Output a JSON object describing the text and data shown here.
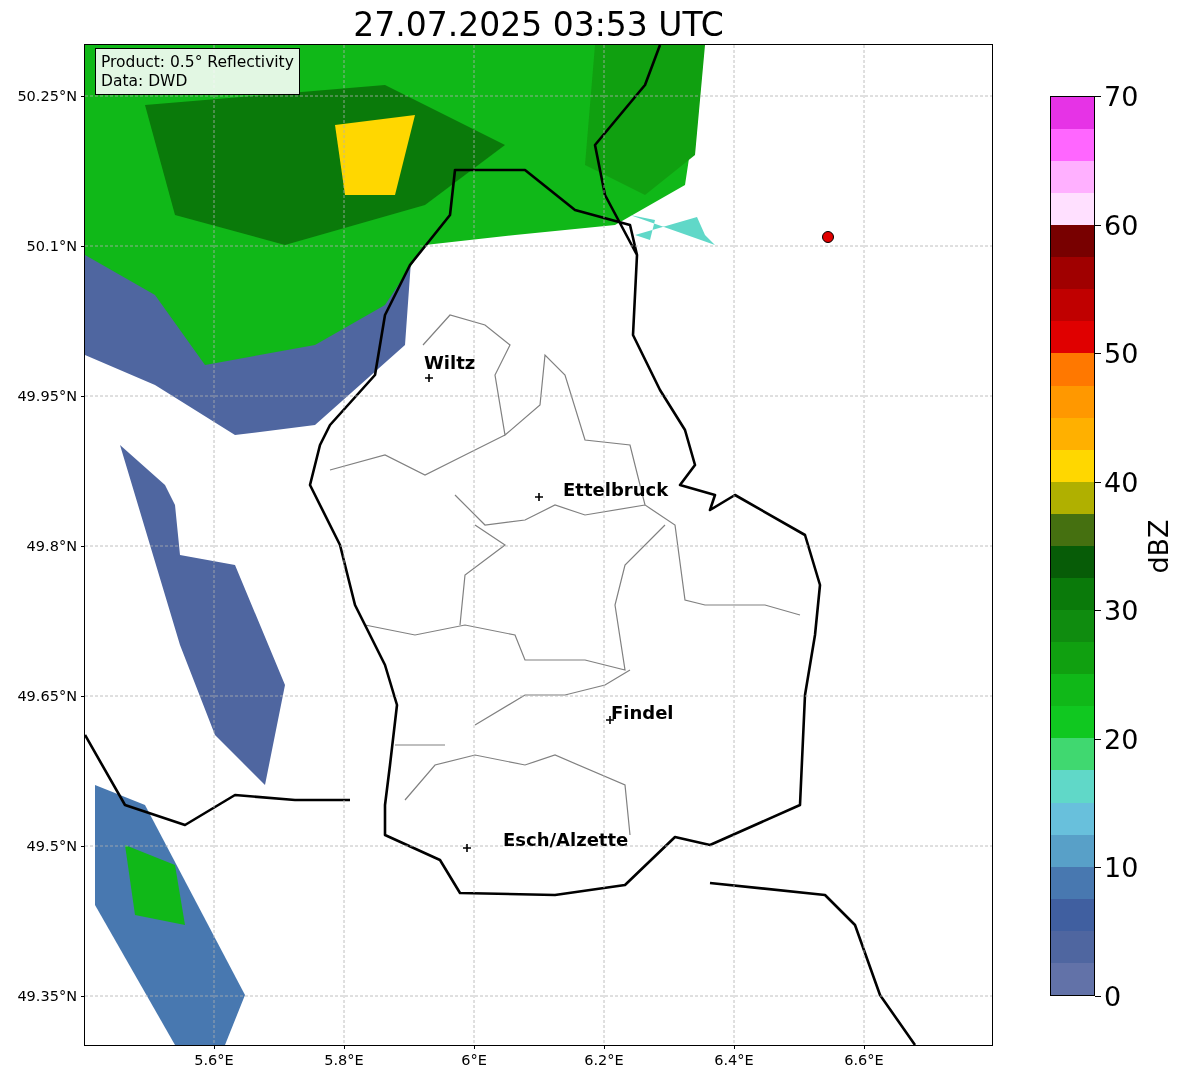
{
  "title": "27.07.2025 03:53 UTC",
  "info_box": {
    "lines": [
      "Product: 0.5° Reflectivity",
      "Data: DWD"
    ]
  },
  "map": {
    "cities": [
      {
        "name": "Wiltz"
      },
      {
        "name": "Ettelbruck"
      },
      {
        "name": "Findel"
      },
      {
        "name": "Esch/Alzette"
      }
    ]
  },
  "y_axis": {
    "ticks": [
      "50.25°N",
      "50.1°N",
      "49.95°N",
      "49.8°N",
      "49.65°N",
      "49.5°N",
      "49.35°N"
    ]
  },
  "x_axis": {
    "ticks": [
      "5.6°E",
      "5.8°E",
      "6°E",
      "6.2°E",
      "6.4°E",
      "6.6°E"
    ]
  },
  "colorbar": {
    "label": "dBZ",
    "ticks": [
      "70",
      "60",
      "50",
      "40",
      "30",
      "20",
      "10",
      "0"
    ],
    "bands": [
      {
        "color": "#6272a8"
      },
      {
        "color": "#4f66a0"
      },
      {
        "color": "#405fa0"
      },
      {
        "color": "#4878b0"
      },
      {
        "color": "#58a0c8"
      },
      {
        "color": "#68c0dc"
      },
      {
        "color": "#60d8c8"
      },
      {
        "color": "#40d870"
      },
      {
        "color": "#10c820"
      },
      {
        "color": "#10b818"
      },
      {
        "color": "#10a010"
      },
      {
        "color": "#0f8c0f"
      },
      {
        "color": "#0a7a0a"
      },
      {
        "color": "#075c07"
      },
      {
        "color": "#457010"
      },
      {
        "color": "#b0b000"
      },
      {
        "color": "#ffd700"
      },
      {
        "color": "#ffb000"
      },
      {
        "color": "#ff9800"
      },
      {
        "color": "#ff7800"
      },
      {
        "color": "#e00000"
      },
      {
        "color": "#c00000"
      },
      {
        "color": "#a00000"
      },
      {
        "color": "#780000"
      },
      {
        "color": "#ffe0ff"
      },
      {
        "color": "#ffb0ff"
      },
      {
        "color": "#ff66ff"
      },
      {
        "color": "#e633e6"
      }
    ]
  }
}
